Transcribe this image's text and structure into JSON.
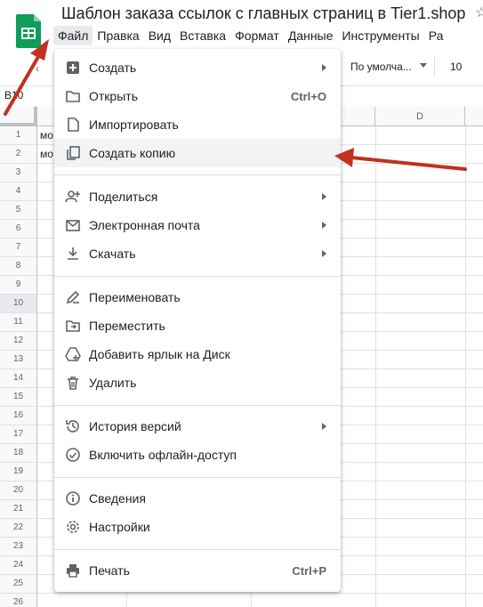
{
  "app": {
    "title": "Шаблон заказа ссылок с главных страниц в Tier1.shop",
    "logo_icon": "google-sheets-icon",
    "brand_color": "#0F9D58"
  },
  "menubar": {
    "items": [
      "Файл",
      "Правка",
      "Вид",
      "Вставка",
      "Формат",
      "Данные",
      "Инструменты",
      "Ра"
    ],
    "active": "Файл"
  },
  "toolbar": {
    "font_family": "По умолча...",
    "font_size": "10"
  },
  "formula_bar": {
    "cell_ref": "B10"
  },
  "grid": {
    "column_headers": [
      "",
      "",
      "",
      "D"
    ],
    "row_numbers": [
      "1",
      "2",
      "3",
      "4",
      "5",
      "6",
      "7",
      "8",
      "9",
      "10",
      "11",
      "12",
      "13",
      "14",
      "15",
      "16",
      "17",
      "18",
      "19",
      "20",
      "21",
      "22",
      "23",
      "24",
      "25",
      "26"
    ],
    "selected_row": "10",
    "cells_col_a": [
      "мо",
      "мо"
    ]
  },
  "file_menu": {
    "groups": [
      [
        {
          "label": "Создать",
          "icon": "plus-icon",
          "submenu": true
        },
        {
          "label": "Открыть",
          "icon": "folder-icon",
          "shortcut": "Ctrl+O"
        },
        {
          "label": "Импортировать",
          "icon": "file-icon"
        },
        {
          "label": "Создать копию",
          "icon": "copy-icon",
          "highlighted": true
        }
      ],
      [
        {
          "label": "Поделиться",
          "icon": "person-add-icon",
          "submenu": true
        },
        {
          "label": "Электронная почта",
          "icon": "mail-icon",
          "submenu": true
        },
        {
          "label": "Скачать",
          "icon": "download-icon",
          "submenu": true
        }
      ],
      [
        {
          "label": "Переименовать",
          "icon": "rename-icon"
        },
        {
          "label": "Переместить",
          "icon": "move-folder-icon"
        },
        {
          "label": "Добавить ярлык на Диск",
          "icon": "drive-shortcut-icon"
        },
        {
          "label": "Удалить",
          "icon": "trash-icon"
        }
      ],
      [
        {
          "label": "История версий",
          "icon": "history-icon",
          "submenu": true
        },
        {
          "label": "Включить офлайн-доступ",
          "icon": "offline-icon"
        }
      ],
      [
        {
          "label": "Сведения",
          "icon": "info-icon"
        },
        {
          "label": "Настройки",
          "icon": "gear-icon"
        }
      ],
      [
        {
          "label": "Печать",
          "icon": "print-icon",
          "shortcut": "Ctrl+P"
        }
      ]
    ]
  },
  "annotations": {
    "arrow_color": "#C0321F"
  }
}
